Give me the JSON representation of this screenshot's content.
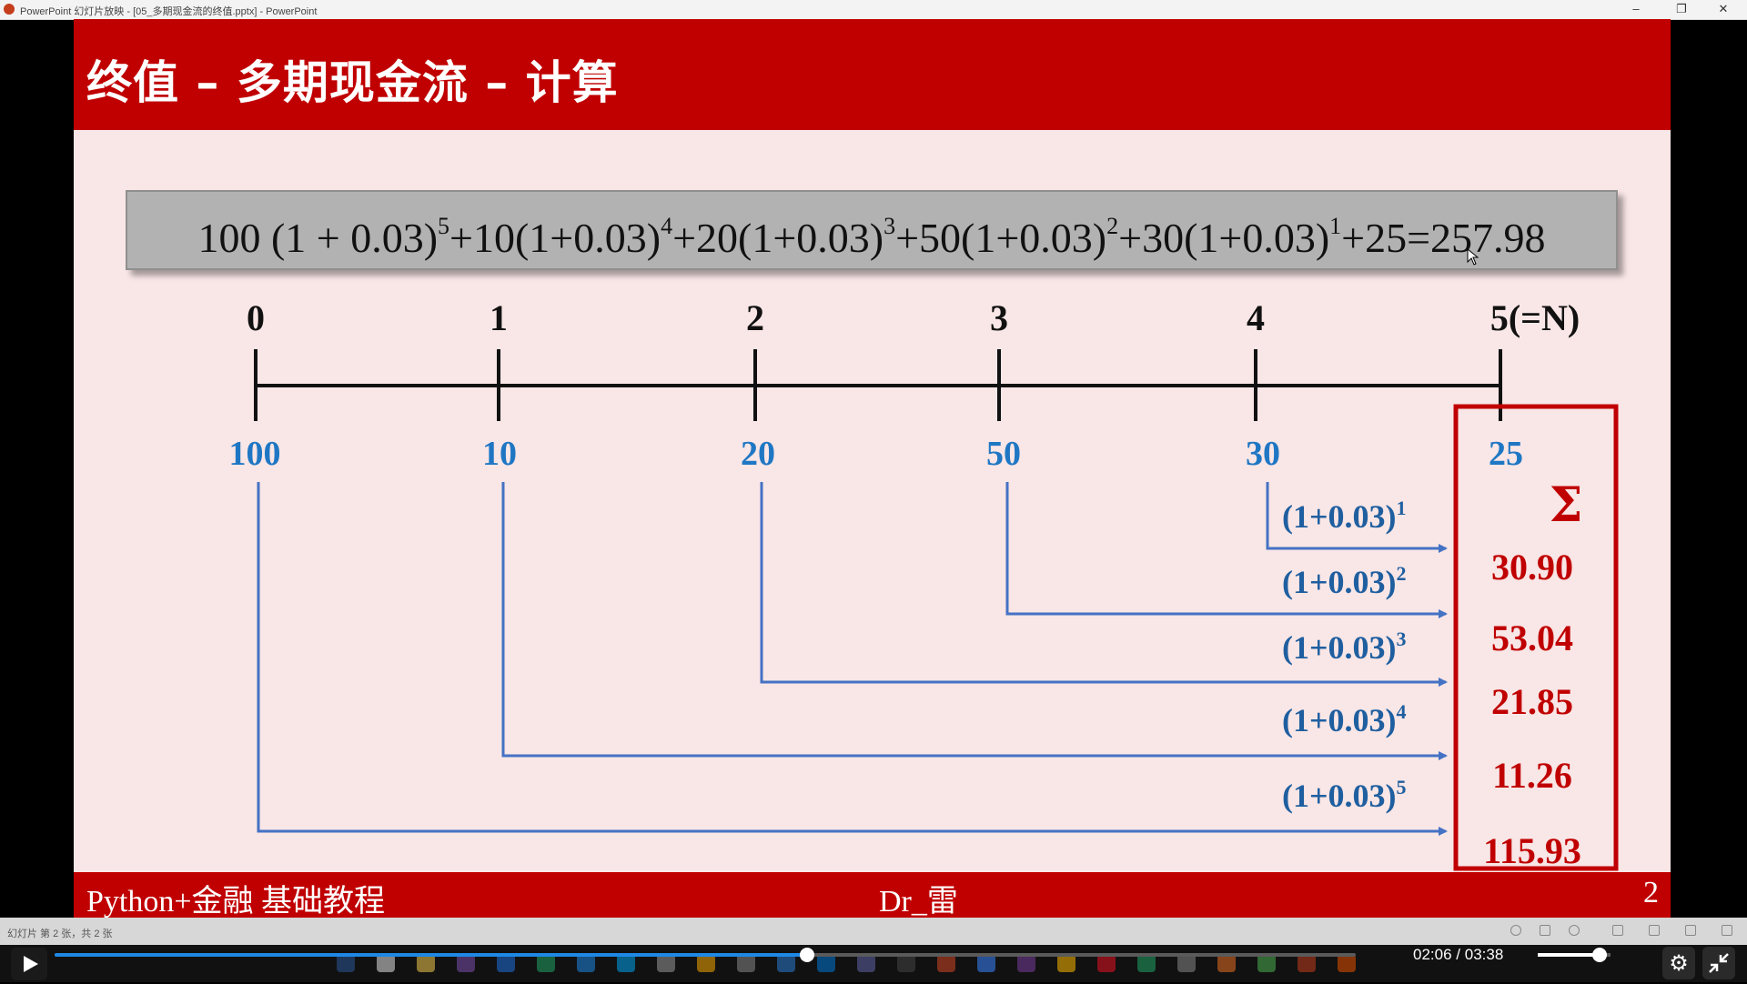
{
  "window": {
    "title": "PowerPoint 幻灯片放映 - [05_多期现金流的终值.pptx] - PowerPoint",
    "minimize_icon": "minimize-icon",
    "restore_icon": "restore-icon",
    "close_icon": "close-icon"
  },
  "slide": {
    "title": "终值 – 多期现金流 – 计算",
    "formula": {
      "parts": [
        {
          "text": "100 (1 + 0.03)",
          "sup": "5"
        },
        {
          "text": "+10(1+0.03)",
          "sup": "4"
        },
        {
          "text": "+20(1+0.03)",
          "sup": "3"
        },
        {
          "text": "+50(1+0.03)",
          "sup": "2"
        },
        {
          "text": "+30(1+0.03)",
          "sup": "1"
        }
      ],
      "tail": "+25=257.98"
    },
    "timeline": {
      "periods": [
        "0",
        "1",
        "2",
        "3",
        "4",
        "5(=N)"
      ],
      "cash_flows": [
        "100",
        "10",
        "20",
        "50",
        "30",
        "25"
      ]
    },
    "factors": [
      {
        "base": "(1+0.03)",
        "exp": "1"
      },
      {
        "base": "(1+0.03)",
        "exp": "2"
      },
      {
        "base": "(1+0.03)",
        "exp": "3"
      },
      {
        "base": "(1+0.03)",
        "exp": "4"
      },
      {
        "base": "(1+0.03)",
        "exp": "5"
      }
    ],
    "future_values": [
      "30.90",
      "53.04",
      "21.85",
      "11.26",
      "115.93"
    ],
    "sigma": "Σ",
    "footer": {
      "left": "Python+金融 基础教程",
      "center": "Dr_雷",
      "page": "2"
    },
    "colors": {
      "header": "#c00000",
      "background": "#f9e6e6",
      "cash_flow_blue": "#1f77c4",
      "arrow_blue": "#4472c4",
      "factor_blue": "#1f5fa0",
      "result_red": "#c00000"
    }
  },
  "statusbar": {
    "text": "幻灯片 第 2 张，共 2 张"
  },
  "player": {
    "current_time": "02:06",
    "separator": "/",
    "duration": "03:38",
    "progress": 0.578,
    "volume": 0.85,
    "play_icon": "play-icon",
    "settings_icon": "gear-icon",
    "exit_fullscreen_icon": "exit-fullscreen-icon"
  }
}
